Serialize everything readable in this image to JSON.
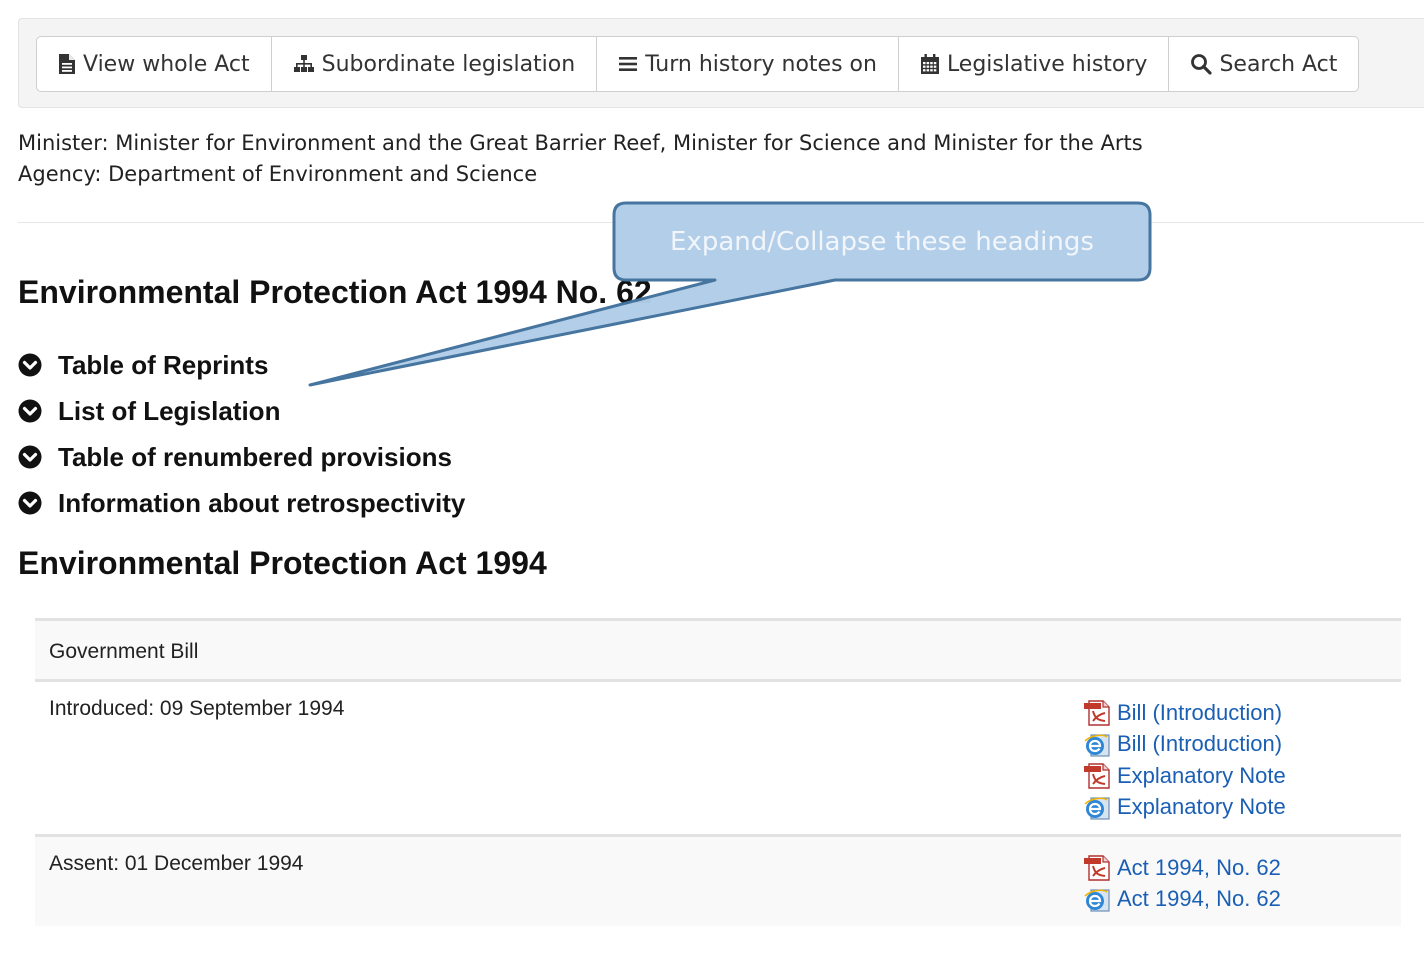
{
  "toolbar": {
    "buttons": [
      {
        "label": "View whole Act",
        "icon": "file-text-icon"
      },
      {
        "label": "Subordinate legislation",
        "icon": "sitemap-icon"
      },
      {
        "label": "Turn history notes on",
        "icon": "list-icon"
      },
      {
        "label": "Legislative history",
        "icon": "calendar-icon"
      },
      {
        "label": "Search Act",
        "icon": "search-icon"
      }
    ]
  },
  "meta": {
    "minister": "Minister: Minister for Environment and the Great Barrier Reef, Minister for Science and Minister for the Arts",
    "agency": "Agency: Department of Environment and Science"
  },
  "main": {
    "title": "Environmental Protection Act 1994 No. 62",
    "sections": [
      {
        "label": "Table of Reprints",
        "icon": "chevron-circle-down-icon"
      },
      {
        "label": "List of Legislation",
        "icon": "chevron-circle-down-icon"
      },
      {
        "label": "Table of renumbered provisions",
        "icon": "chevron-circle-down-icon"
      },
      {
        "label": "Information about retrospectivity",
        "icon": "chevron-circle-down-icon"
      }
    ],
    "history_title": "Environmental Protection Act 1994"
  },
  "history": {
    "bill_type": "Government Bill",
    "introduced": {
      "label": "Introduced: 09 September 1994",
      "links": [
        {
          "label": "Bill (Introduction)",
          "type": "pdf"
        },
        {
          "label": "Bill (Introduction)",
          "type": "html"
        },
        {
          "label": "Explanatory Note",
          "type": "pdf"
        },
        {
          "label": "Explanatory Note",
          "type": "html"
        }
      ]
    },
    "assent": {
      "label": "Assent: 01 December 1994",
      "links": [
        {
          "label": "Act 1994, No. 62",
          "type": "pdf"
        },
        {
          "label": "Act 1994, No. 62",
          "type": "html"
        }
      ]
    }
  },
  "annotation": {
    "text": "Expand/Collapse these headings",
    "fill": "#b0cde9",
    "stroke": "#41719c"
  },
  "colors": {
    "link": "#1a5fb4",
    "toolbar_bg": "#f4f4f4",
    "row_shade": "#f9f9f9"
  }
}
